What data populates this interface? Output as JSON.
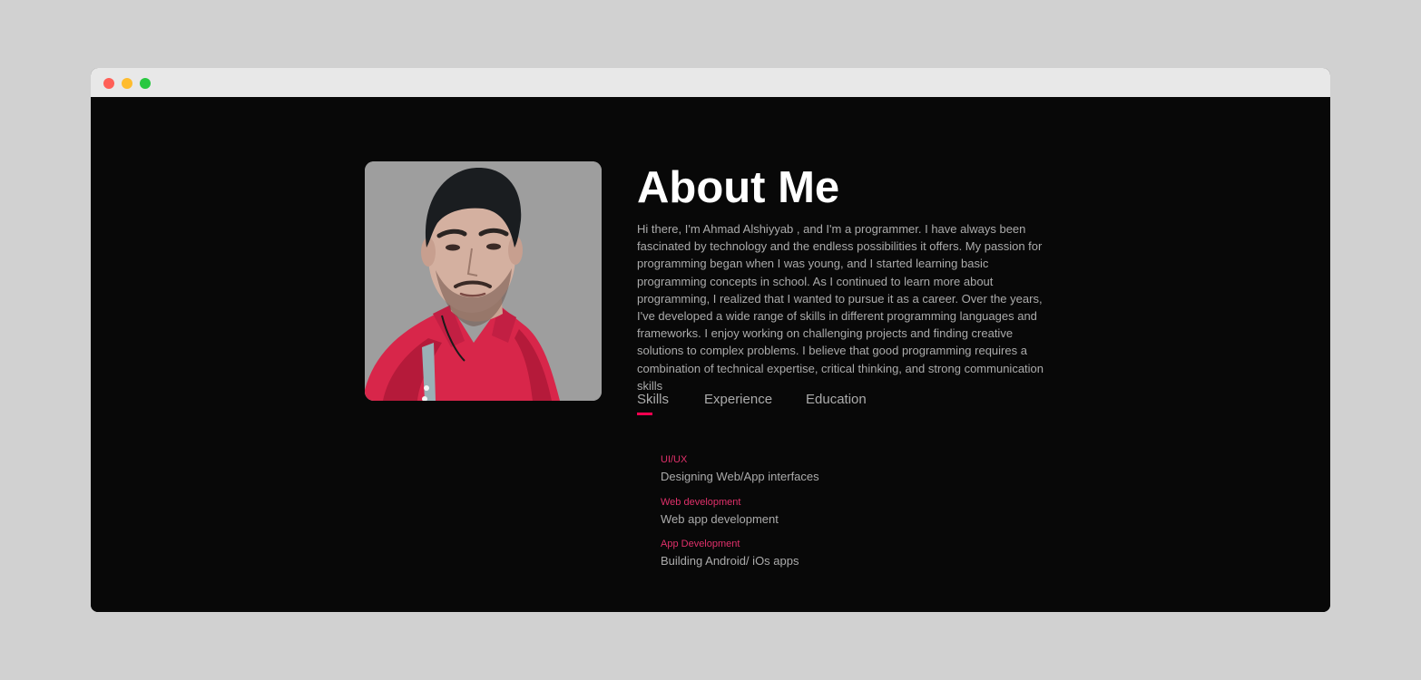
{
  "window": {
    "controls": [
      "close",
      "minimize",
      "maximize"
    ]
  },
  "about": {
    "title": "About Me",
    "paragraph": "Hi there, I'm Ahmad Alshiyyab , and I'm a programmer. I have always been fascinated by technology and the endless possibilities it offers. My passion for programming began when I was young, and I started learning basic programming concepts in school. As I continued to learn more about programming, I realized that I wanted to pursue it as a career. Over the years, I've developed a wide range of skills in different programming languages and frameworks. I enjoy working on challenging projects and finding creative solutions to complex problems. I believe that good programming requires a combination of technical expertise, critical thinking, and strong communication skills"
  },
  "tabs": [
    {
      "label": "Skills",
      "active": true
    },
    {
      "label": "Experience",
      "active": false
    },
    {
      "label": "Education",
      "active": false
    }
  ],
  "skills": [
    {
      "name": "UI/UX",
      "desc": "Designing Web/App interfaces"
    },
    {
      "name": "Web development",
      "desc": "Web app development"
    },
    {
      "name": "App Development",
      "desc": "Building Android/ iOs apps"
    }
  ],
  "colors": {
    "accent": "#ff004f",
    "skill_title": "#e0306a",
    "text": "#ababab",
    "background": "#080808",
    "heading": "#ffffff"
  }
}
